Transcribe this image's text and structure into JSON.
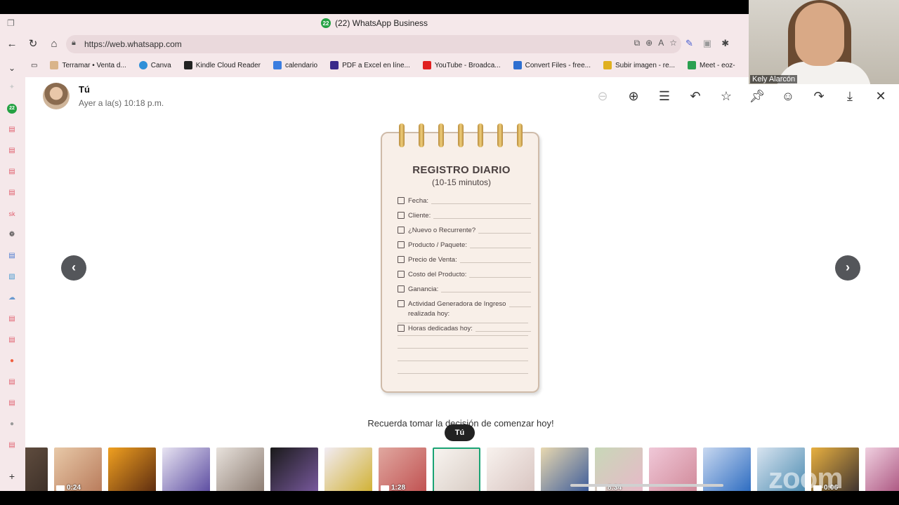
{
  "window": {
    "title": "(22) WhatsApp Business",
    "badge": "22"
  },
  "address": {
    "url": "https://web.whatsapp.com"
  },
  "bookmarks": [
    {
      "label": "Terramar • Venta d...",
      "color": "#d9b48a"
    },
    {
      "label": "Canva",
      "color": "#2f8fd8"
    },
    {
      "label": "Kindle Cloud Reader",
      "color": "#222222"
    },
    {
      "label": "calendario",
      "color": "#3b7de0"
    },
    {
      "label": "PDF a Excel en líne...",
      "color": "#3a2a8a"
    },
    {
      "label": "YouTube - Broadca...",
      "color": "#e02020"
    },
    {
      "label": "Convert Files - free...",
      "color": "#2f6fd0"
    },
    {
      "label": "Subir imagen - re...",
      "color": "#e0b020"
    },
    {
      "label": "Meet - eoz-",
      "color": "#2aa050"
    }
  ],
  "sidebar": {
    "badge": "22",
    "sk": "sk"
  },
  "viewer": {
    "sender": "Tú",
    "timestamp": "Ayer a la(s) 10:18 p.m.",
    "caption": "Recuerda tomar la decisión de comenzar hoy!",
    "tooltip": "Tú"
  },
  "notebook": {
    "title": "REGISTRO DIARIO",
    "subtitle": "(10-15 minutos)",
    "items": [
      "Fecha:",
      "Cliente:",
      "¿Nuevo o Recurrente?",
      "Producto / Paquete:",
      "Precio de Venta:",
      "Costo del Producto:",
      "Ganancia:",
      "Actividad Generadora de Ingreso realizada hoy:",
      "Horas dedicadas hoy:"
    ]
  },
  "thumbnails": [
    {
      "colors": [
        "#6b5646",
        "#3d3028"
      ],
      "duration": ""
    },
    {
      "colors": [
        "#e8c9a8",
        "#b87a5a"
      ],
      "duration": "0:24"
    },
    {
      "colors": [
        "#f0a020",
        "#5a2a10"
      ],
      "duration": ""
    },
    {
      "colors": [
        "#e8e4f2",
        "#5a4aa0"
      ],
      "duration": ""
    },
    {
      "colors": [
        "#e8e2dc",
        "#8a7a70"
      ],
      "duration": ""
    },
    {
      "colors": [
        "#1a1a1a",
        "#7a5aa0"
      ],
      "duration": ""
    },
    {
      "colors": [
        "#f2ecf4",
        "#d0b030"
      ],
      "duration": ""
    },
    {
      "colors": [
        "#e0a8a0",
        "#c05050"
      ],
      "duration": "1:28"
    },
    {
      "colors": [
        "#f8f4f0",
        "#d8ccc4"
      ],
      "duration": ""
    },
    {
      "colors": [
        "#f8f2ee",
        "#d8c4c0"
      ],
      "duration": ""
    },
    {
      "colors": [
        "#e8d8b0",
        "#3a5a9a"
      ],
      "duration": ""
    },
    {
      "colors": [
        "#c8d8b8",
        "#e8b8c8"
      ],
      "duration": "8:34"
    },
    {
      "colors": [
        "#f0c8d8",
        "#d08898"
      ],
      "duration": ""
    },
    {
      "colors": [
        "#c8d8f0",
        "#2a6ac0"
      ],
      "duration": ""
    },
    {
      "colors": [
        "#d8e4f0",
        "#4a8ab0"
      ],
      "duration": ""
    },
    {
      "colors": [
        "#e8b040",
        "#3a3030"
      ],
      "duration": "0:06"
    },
    {
      "colors": [
        "#f0d0e0",
        "#a04070"
      ],
      "duration": ""
    }
  ],
  "zoom": {
    "participant": "Kely Alarcón",
    "watermark": "zoom"
  },
  "colors": {
    "accent": "#1aa374",
    "chrome": "#f5e8ea",
    "arrow": "#54565a"
  }
}
